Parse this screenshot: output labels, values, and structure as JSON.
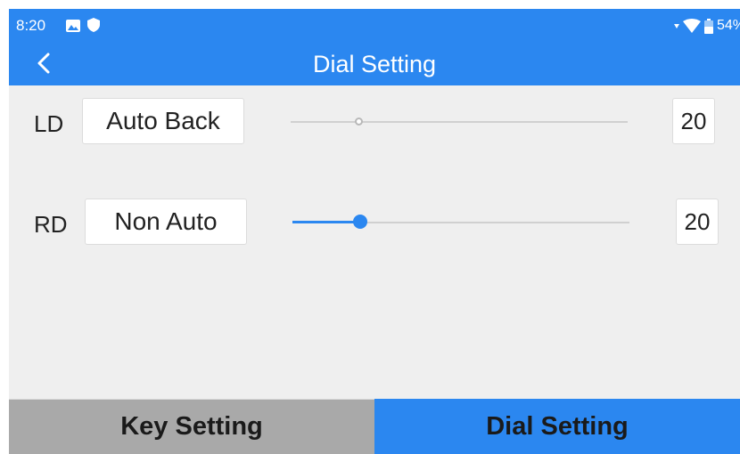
{
  "status_bar": {
    "time": "8:20",
    "battery_percent": "54%",
    "icons": [
      "picture-icon",
      "shield-icon",
      "data-arrow-icon",
      "wifi-icon",
      "battery-icon"
    ]
  },
  "header": {
    "title": "Dial Setting",
    "back_icon": "chevron-left-icon"
  },
  "dials": [
    {
      "label": "LD",
      "mode": "Auto Back",
      "value": "20",
      "slider_fraction": 0.2,
      "enabled": false
    },
    {
      "label": "RD",
      "mode": "Non Auto",
      "value": "20",
      "slider_fraction": 0.2,
      "enabled": true
    }
  ],
  "tabs": [
    {
      "label": "Key Setting",
      "active": false
    },
    {
      "label": "Dial Setting",
      "active": true
    }
  ],
  "colors": {
    "accent": "#2b87f0",
    "background": "#efefef",
    "tab_inactive": "#a9a9a9"
  }
}
